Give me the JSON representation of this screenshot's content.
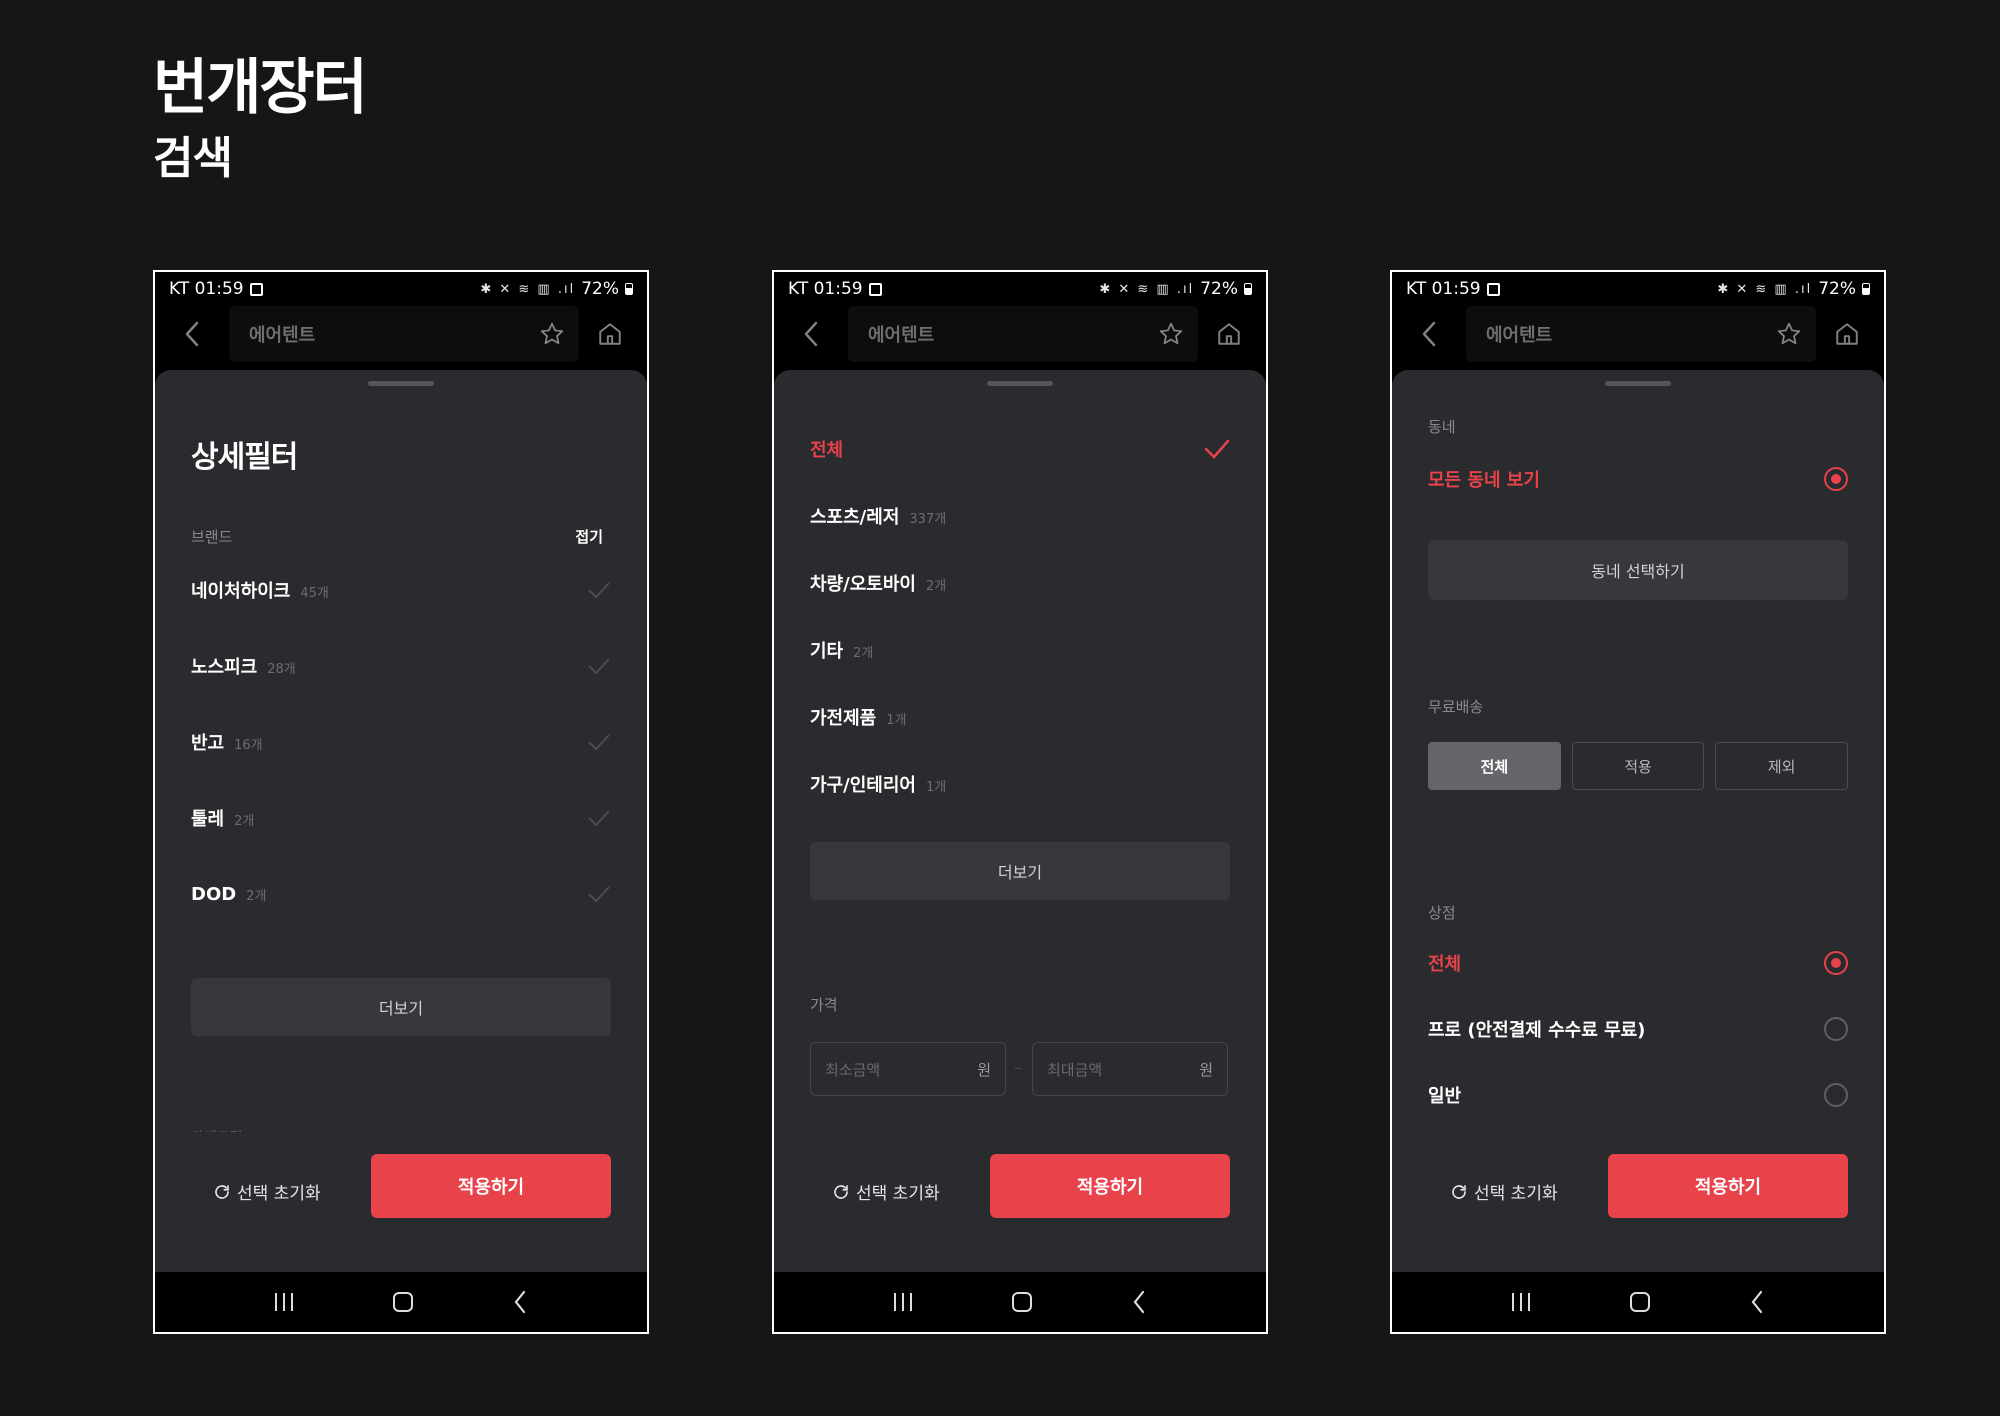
{
  "page": {
    "title": "번개장터",
    "subtitle": "검색"
  },
  "common": {
    "carrier_time": "KT 01:59",
    "battery": "72%",
    "search_query": "에어텐트",
    "reset_label": "선택 초기화",
    "apply_label": "적용하기"
  },
  "screen1": {
    "title": "상세필터",
    "brand_label": "브랜드",
    "fold_label": "접기",
    "brands": [
      {
        "name": "네이처하이크",
        "count": "45개"
      },
      {
        "name": "노스피크",
        "count": "28개"
      },
      {
        "name": "반고",
        "count": "16개"
      },
      {
        "name": "툴레",
        "count": "2개"
      },
      {
        "name": "DOD",
        "count": "2개"
      }
    ],
    "more_label": "더보기",
    "category_label": "카테고리"
  },
  "screen2": {
    "categories": [
      {
        "name": "전체",
        "count": "",
        "selected": true
      },
      {
        "name": "스포츠/레저",
        "count": "337개"
      },
      {
        "name": "차량/오토바이",
        "count": "2개"
      },
      {
        "name": "기타",
        "count": "2개"
      },
      {
        "name": "가전제품",
        "count": "1개"
      },
      {
        "name": "가구/인테리어",
        "count": "1개"
      }
    ],
    "more_label": "더보기",
    "price_label": "가격",
    "min_placeholder": "최소금액",
    "max_placeholder": "최대금액",
    "unit": "원",
    "dash": "–"
  },
  "screen3": {
    "neighborhood_label": "동네",
    "all_neighborhood": "모든 동네 보기",
    "select_neighborhood": "동네 선택하기",
    "free_shipping_label": "무료배송",
    "shipping_options": [
      "전체",
      "적용",
      "제외"
    ],
    "store_label": "상점",
    "store_options": [
      "전체",
      "프로 (안전결제 수수료 무료)",
      "일반"
    ]
  },
  "colors": {
    "accent": "#e8424b",
    "sheet": "#2a2b2e",
    "background": "#161616"
  }
}
